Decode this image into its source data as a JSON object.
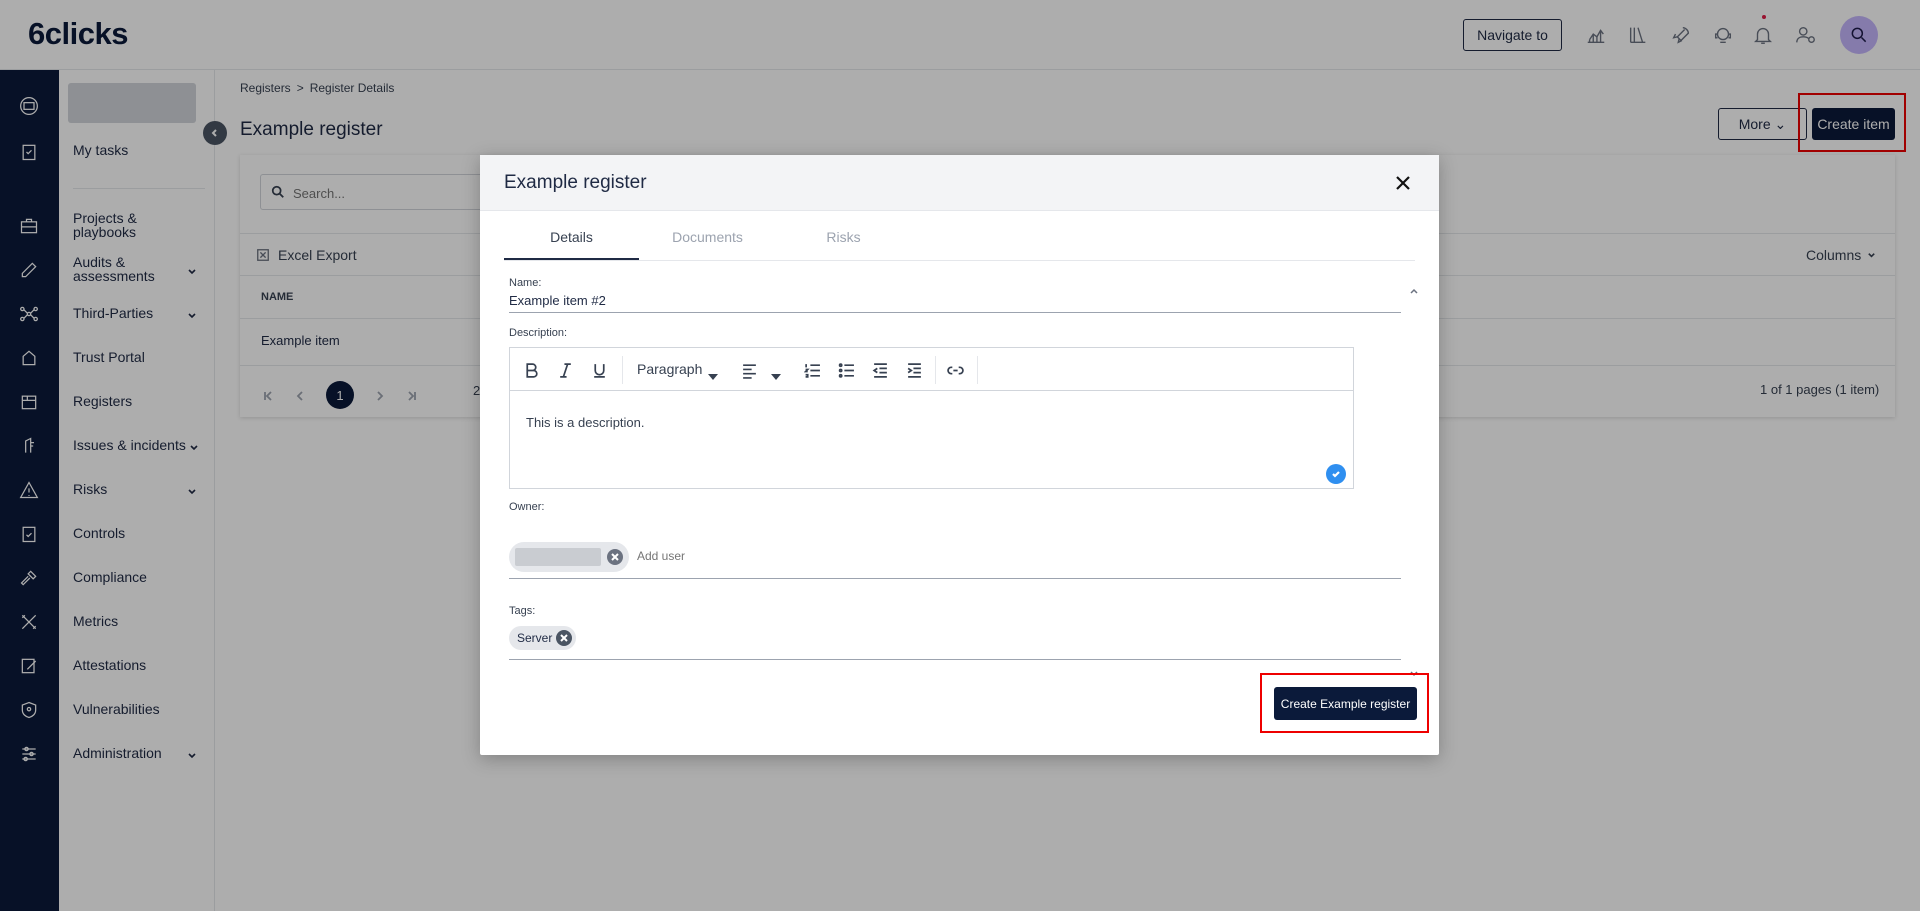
{
  "app": {
    "logo_text": "6clicks"
  },
  "topbar": {
    "navigate_label": "Navigate to",
    "icons": [
      "chart-icon",
      "library-icon",
      "rocket-icon",
      "support-icon",
      "bell-icon",
      "user-settings-icon",
      "avatar-search-icon"
    ]
  },
  "rail": {
    "icons": [
      "home-icon",
      "tasks-icon",
      "briefcase-icon",
      "edit-icon",
      "network-icon",
      "trust-icon",
      "register-icon",
      "issue-icon",
      "warning-icon",
      "controls-icon",
      "gavel-icon",
      "tools-icon",
      "attestation-icon",
      "shield-icon",
      "sliders-icon"
    ]
  },
  "sidebar": {
    "items": [
      {
        "label": "My tasks"
      },
      {
        "label": "Projects & playbooks"
      },
      {
        "label": "Audits & assessments"
      },
      {
        "label": "Third-Parties"
      },
      {
        "label": "Trust Portal"
      },
      {
        "label": "Registers"
      },
      {
        "label": "Issues & incidents"
      },
      {
        "label": "Risks"
      },
      {
        "label": "Controls"
      },
      {
        "label": "Compliance"
      },
      {
        "label": "Metrics"
      },
      {
        "label": "Attestations"
      },
      {
        "label": "Vulnerabilities"
      },
      {
        "label": "Administration"
      }
    ]
  },
  "breadcrumb": {
    "parent": "Registers",
    "sep": ">",
    "current": "Register Details"
  },
  "page": {
    "title": "Example register",
    "more_label": "More",
    "create_item_label": "Create item"
  },
  "table": {
    "search_placeholder": "Search...",
    "excel_label": "Excel Export",
    "columns_label": "Columns",
    "header_name": "NAME",
    "rows": [
      {
        "name": "Example item"
      }
    ],
    "current_page": "1",
    "page_size": "2",
    "pager_info": "1 of 1 pages (1 item)"
  },
  "modal": {
    "title": "Example register",
    "tabs": [
      {
        "label": "Details",
        "active": true
      },
      {
        "label": "Documents",
        "active": false
      },
      {
        "label": "Risks",
        "active": false
      }
    ],
    "name_label": "Name:",
    "name_value": "Example item #2",
    "description_label": "Description:",
    "toolbar": {
      "paragraph": "Paragraph"
    },
    "description_text": "This is a description.",
    "owner_label": "Owner:",
    "add_user_placeholder": "Add user",
    "tags_label": "Tags:",
    "tags": [
      "Server"
    ],
    "submit_label": "Create Example register"
  },
  "colors": {
    "navy": "#0b1a3a",
    "highlight": "#e00000",
    "check": "#2f8ff0"
  }
}
